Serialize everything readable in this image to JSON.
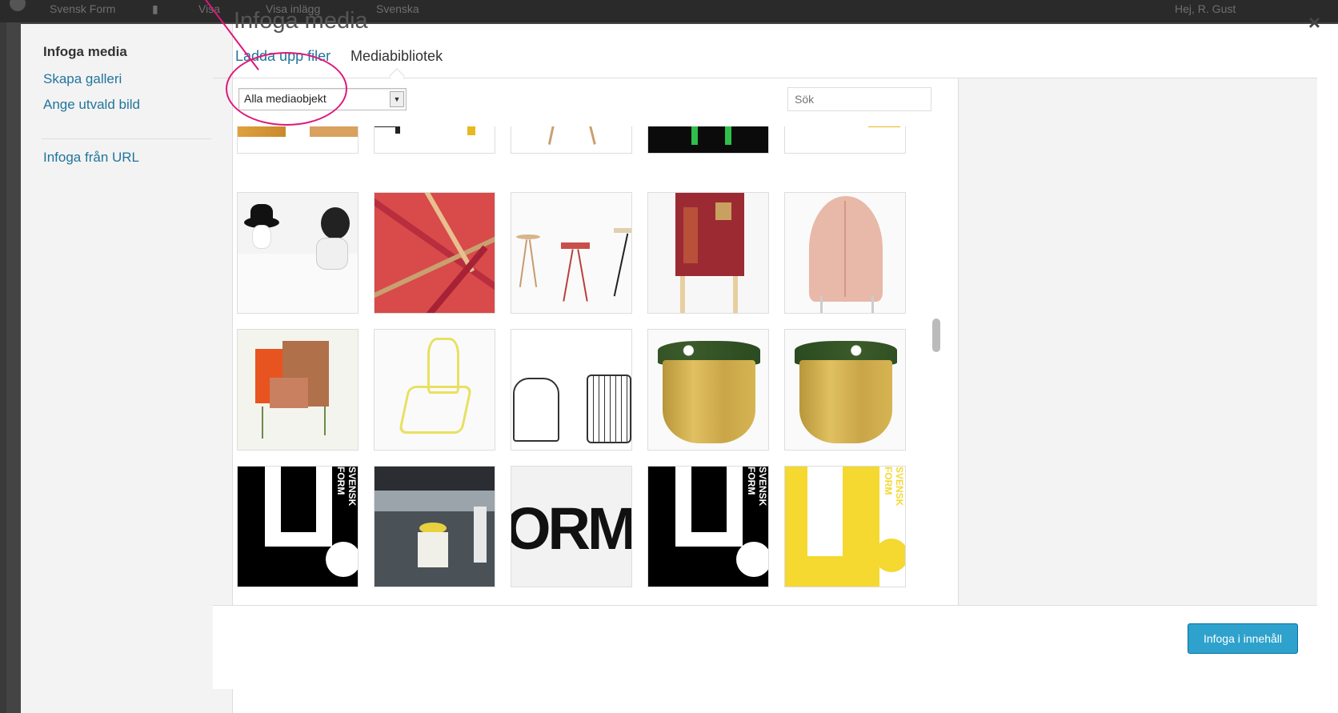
{
  "admin_bar": {
    "site_name": "Svensk Form",
    "view_label": "Visa",
    "view_post_label": "Visa inlägg",
    "language_label": "Svenska",
    "greeting": "Hej, R. Gust"
  },
  "sidebar": {
    "items": [
      {
        "label": "Infoga media",
        "active": true
      },
      {
        "label": "Skapa galleri",
        "active": false
      },
      {
        "label": "Ange utvald bild",
        "active": false
      },
      {
        "label": "Infoga från URL",
        "active": false
      }
    ]
  },
  "modal": {
    "title": "Infoga media",
    "close_symbol": "×"
  },
  "router": {
    "tabs": [
      {
        "label": "Ladda upp filer",
        "active": false
      },
      {
        "label": "Mediabibliotek",
        "active": true
      }
    ]
  },
  "toolbar": {
    "filter_selected": "Alla mediaobjekt",
    "search_placeholder": "Sök"
  },
  "footer": {
    "insert_button": "Infoga i innehåll"
  },
  "media_grid": {
    "rows": [
      [
        "top-crop-table-wood",
        "top-crop-benches",
        "top-crop-stool-legs",
        "top-crop-green-dark",
        "top-crop-benches-2"
      ],
      [
        "masked-figures",
        "red-pink-sticks",
        "three-stools",
        "red-cabinet",
        "pink-canopy-chair"
      ],
      [
        "orange-brown-chair",
        "yellow-wire-chair",
        "black-wire-chairs",
        "gold-planter-flowers",
        "gold-planter-flowers-2"
      ],
      [
        "svensk-form-black",
        "parking-garage-stools",
        "orm-logo",
        "svensk-form-black-2",
        "svensk-form-yellow"
      ]
    ],
    "poster_text": "SVENSK FORM",
    "orm_text": "ORM"
  },
  "annotation": {
    "color": "#e0177b"
  }
}
